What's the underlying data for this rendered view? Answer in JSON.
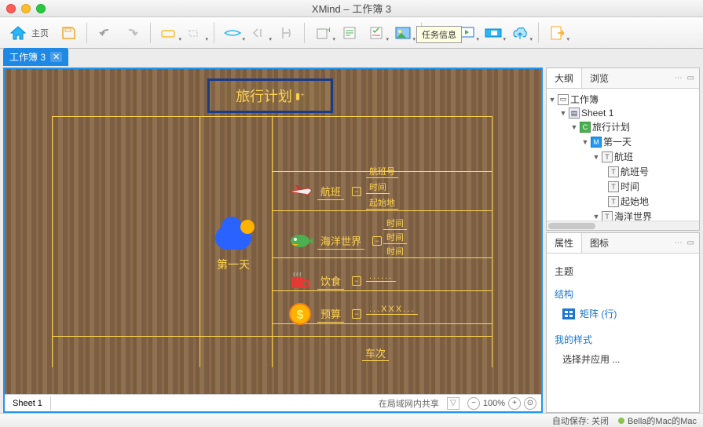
{
  "window": {
    "title": "XMind – 工作簿 3"
  },
  "toolbar": {
    "home_label": "主页",
    "tooltip": "任务信息"
  },
  "file_tab": {
    "name": "工作簿 3"
  },
  "sheet": {
    "name": "Sheet 1",
    "share_text": "在局域网内共享",
    "zoom": "100%"
  },
  "mindmap": {
    "root": "旅行计划",
    "day_label": "第一天",
    "cats": {
      "flight": {
        "label": "航班",
        "subs": [
          "航班号",
          "时间",
          "起始地"
        ]
      },
      "ocean": {
        "label": "海洋世界",
        "subs": [
          "时间",
          "时间",
          "时间"
        ]
      },
      "food": {
        "label": "饮食",
        "subs": [
          "......"
        ]
      },
      "budget": {
        "label": "预算",
        "subs": [
          "...XXX..."
        ]
      },
      "train": {
        "label": "车次"
      }
    }
  },
  "panels": {
    "outline_tab": "大纲",
    "browse_tab": "浏览",
    "props_tab": "属性",
    "icons_tab": "图标",
    "topic_label": "主题",
    "structure_label": "结构",
    "matrix_label": "矩阵 (行)",
    "mystyle_label": "我的样式",
    "apply_label": "选择并应用 ..."
  },
  "tree": {
    "workbook": "工作簿",
    "sheet": "Sheet 1",
    "root": "旅行计划",
    "day": "第一天",
    "flight": "航班",
    "flight_no": "航班号",
    "time": "时间",
    "origin": "起始地",
    "ocean": "海洋世界"
  },
  "status": {
    "autosave": "自动保存: 关闭",
    "user": "Bella的Mac的Mac"
  }
}
